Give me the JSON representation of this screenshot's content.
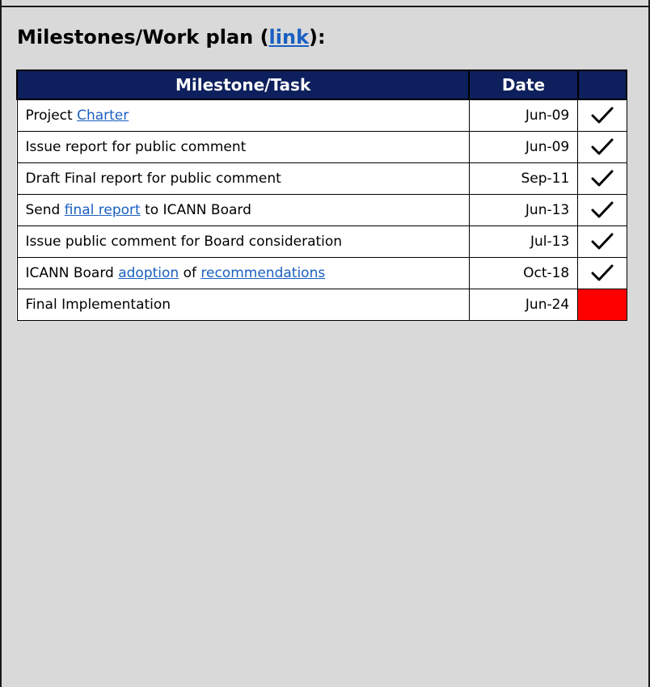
{
  "section": {
    "heading_prefix": "Milestones/Work plan (",
    "heading_link": "link",
    "heading_suffix": "):"
  },
  "table": {
    "headers": {
      "task": "Milestone/Task",
      "date": "Date",
      "status": ""
    },
    "rows": [
      {
        "pre": "Project ",
        "link1": "Charter",
        "mid": "",
        "link2": "",
        "post": "",
        "date": "Jun-09",
        "status": "done"
      },
      {
        "pre": "Issue report for public comment",
        "link1": "",
        "mid": "",
        "link2": "",
        "post": "",
        "date": "Jun-09",
        "status": "done"
      },
      {
        "pre": "Draft Final report for public comment",
        "link1": "",
        "mid": "",
        "link2": "",
        "post": "",
        "date": "Sep-11",
        "status": "done"
      },
      {
        "pre": "Send ",
        "link1": "final report",
        "mid": " to ICANN Board",
        "link2": "",
        "post": "",
        "date": "Jun-13",
        "status": "done"
      },
      {
        "pre": "Issue public comment for Board consideration",
        "link1": "",
        "mid": "",
        "link2": "",
        "post": "",
        "date": "Jul-13",
        "status": "done"
      },
      {
        "pre": "ICANN Board ",
        "link1": "adoption",
        "mid": " of ",
        "link2": "recommendations",
        "post": "",
        "date": "Oct-18",
        "status": "done"
      },
      {
        "pre": "Final Implementation",
        "link1": "",
        "mid": "",
        "link2": "",
        "post": "",
        "date": "Jun-24",
        "status": "pending"
      }
    ]
  },
  "colors": {
    "header_bg": "#0d1f5c",
    "link": "#1a5fc2",
    "pending": "#ff0000",
    "panel_bg": "#d9d9d9"
  },
  "icons": {
    "done": "checkmark-icon"
  }
}
